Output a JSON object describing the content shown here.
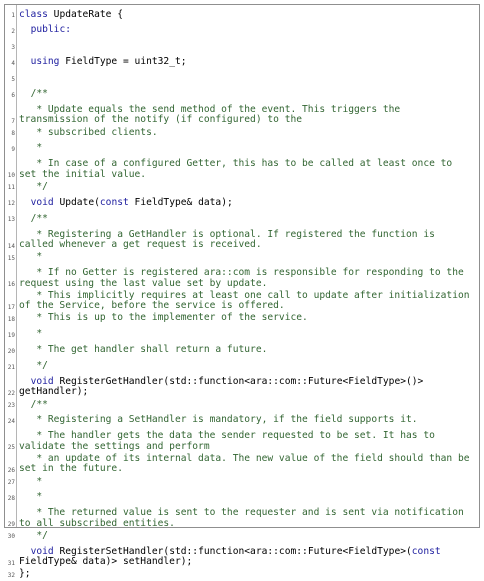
{
  "listing": {
    "lines": [
      {
        "n": "1",
        "parts": [
          {
            "t": "class",
            "c": "kw"
          },
          {
            "t": " UpdateRate {",
            "c": ""
          }
        ]
      },
      {
        "n": "2",
        "parts": [
          {
            "t": "  public:",
            "c": "kw"
          }
        ]
      },
      {
        "n": "3",
        "parts": [
          {
            "t": "",
            "c": ""
          }
        ]
      },
      {
        "n": "4",
        "parts": [
          {
            "t": "  using",
            "c": "kw"
          },
          {
            "t": " FieldType = uint32_t;",
            "c": ""
          }
        ]
      },
      {
        "n": "5",
        "parts": [
          {
            "t": "",
            "c": ""
          }
        ]
      },
      {
        "n": "6",
        "parts": [
          {
            "t": "  /**",
            "c": "cm"
          }
        ]
      },
      {
        "n": "7",
        "parts": [
          {
            "t": "   * Update equals the send method of the event. This triggers the transmission of the notify (if configured) to the",
            "c": "cm"
          }
        ]
      },
      {
        "n": "8",
        "parts": [
          {
            "t": "   * subscribed clients.",
            "c": "cm"
          }
        ]
      },
      {
        "n": "9",
        "parts": [
          {
            "t": "   *",
            "c": "cm"
          }
        ]
      },
      {
        "n": "10",
        "parts": [
          {
            "t": "   * In case of a configured Getter, this has to be called at least once to set the initial value.",
            "c": "cm"
          }
        ]
      },
      {
        "n": "11",
        "parts": [
          {
            "t": "   */",
            "c": "cm"
          }
        ]
      },
      {
        "n": "12",
        "parts": [
          {
            "t": "  void",
            "c": "kw"
          },
          {
            "t": " Update(",
            "c": ""
          },
          {
            "t": "const",
            "c": "kw"
          },
          {
            "t": " FieldType& data);",
            "c": ""
          }
        ]
      },
      {
        "n": "13",
        "parts": [
          {
            "t": "  /**",
            "c": "cm"
          }
        ]
      },
      {
        "n": "14",
        "parts": [
          {
            "t": "   * Registering a GetHandler is optional. If registered the function is called whenever a get request is received.",
            "c": "cm"
          }
        ]
      },
      {
        "n": "15",
        "parts": [
          {
            "t": "   *",
            "c": "cm"
          }
        ]
      },
      {
        "n": "16",
        "parts": [
          {
            "t": "   * If no Getter is registered ara::com is responsible for responding to the request using the last value set by update.",
            "c": "cm"
          }
        ]
      },
      {
        "n": "17",
        "parts": [
          {
            "t": "   * This implicitly requires at least one call to update after initialization of the Service, before the service is offered.",
            "c": "cm"
          }
        ]
      },
      {
        "n": "18",
        "parts": [
          {
            "t": "   * This is up to the implementer of the service.",
            "c": "cm"
          }
        ]
      },
      {
        "n": "19",
        "parts": [
          {
            "t": "   *",
            "c": "cm"
          }
        ]
      },
      {
        "n": "20",
        "parts": [
          {
            "t": "   * The get handler shall return a future.",
            "c": "cm"
          }
        ]
      },
      {
        "n": "21",
        "parts": [
          {
            "t": "   */",
            "c": "cm"
          }
        ]
      },
      {
        "n": "22",
        "parts": [
          {
            "t": "  void",
            "c": "kw"
          },
          {
            "t": " RegisterGetHandler(std::function<ara::com::Future<FieldType>()> getHandler);",
            "c": ""
          }
        ]
      },
      {
        "n": "23",
        "parts": [
          {
            "t": "  /**",
            "c": "cm"
          }
        ]
      },
      {
        "n": "24",
        "parts": [
          {
            "t": "   * Registering a SetHandler is mandatory, if the field supports it.",
            "c": "cm"
          }
        ]
      },
      {
        "n": "25",
        "parts": [
          {
            "t": "   * The handler gets the data the sender requested to be set. It has to validate the settings and perform",
            "c": "cm"
          }
        ]
      },
      {
        "n": "26",
        "parts": [
          {
            "t": "   * an update of its internal data. The new value of the field should than be set in the future.",
            "c": "cm"
          }
        ]
      },
      {
        "n": "27",
        "parts": [
          {
            "t": "   *",
            "c": "cm"
          }
        ]
      },
      {
        "n": "28",
        "parts": [
          {
            "t": "   *",
            "c": "cm"
          }
        ]
      },
      {
        "n": "29",
        "parts": [
          {
            "t": "   * The returned value is sent to the requester and is sent via notification to all subscribed entities.",
            "c": "cm"
          }
        ]
      },
      {
        "n": "30",
        "parts": [
          {
            "t": "   */",
            "c": "cm"
          }
        ]
      },
      {
        "n": "31",
        "parts": [
          {
            "t": "  void",
            "c": "kw"
          },
          {
            "t": " RegisterSetHandler(std::function<ara::com::Future<FieldType>(",
            "c": ""
          },
          {
            "t": "const",
            "c": "kw"
          },
          {
            "t": " FieldType& data)> setHandler);",
            "c": ""
          }
        ]
      },
      {
        "n": "32",
        "parts": [
          {
            "t": "};",
            "c": ""
          }
        ]
      }
    ]
  }
}
